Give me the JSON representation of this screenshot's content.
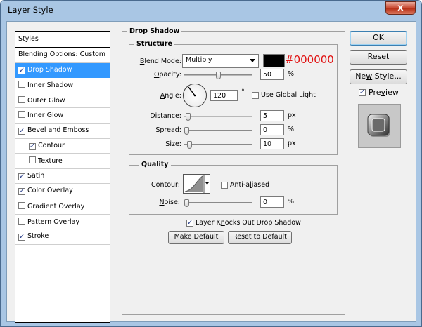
{
  "window": {
    "title": "Layer Style",
    "close_label": "x"
  },
  "styles_panel": {
    "header": "Styles",
    "items": [
      {
        "label": "Blending Options: Custom",
        "checkbox": false,
        "checked": false,
        "indent": false,
        "selected": false
      },
      {
        "label": "Drop Shadow",
        "checkbox": true,
        "checked": true,
        "indent": false,
        "selected": true
      },
      {
        "label": "Inner Shadow",
        "checkbox": true,
        "checked": false,
        "indent": false,
        "selected": false
      },
      {
        "label": "Outer Glow",
        "checkbox": true,
        "checked": false,
        "indent": false,
        "selected": false
      },
      {
        "label": "Inner Glow",
        "checkbox": true,
        "checked": false,
        "indent": false,
        "selected": false
      },
      {
        "label": "Bevel and Emboss",
        "checkbox": true,
        "checked": true,
        "indent": false,
        "selected": false
      },
      {
        "label": "Contour",
        "checkbox": true,
        "checked": true,
        "indent": true,
        "selected": false
      },
      {
        "label": "Texture",
        "checkbox": true,
        "checked": false,
        "indent": true,
        "selected": false
      },
      {
        "label": "Satin",
        "checkbox": true,
        "checked": true,
        "indent": false,
        "selected": false
      },
      {
        "label": "Color Overlay",
        "checkbox": true,
        "checked": true,
        "indent": false,
        "selected": false
      },
      {
        "label": "Gradient Overlay",
        "checkbox": true,
        "checked": false,
        "indent": false,
        "selected": false
      },
      {
        "label": "Pattern Overlay",
        "checkbox": true,
        "checked": false,
        "indent": false,
        "selected": false
      },
      {
        "label": "Stroke",
        "checkbox": true,
        "checked": true,
        "indent": false,
        "selected": false
      }
    ]
  },
  "drop_shadow": {
    "title": "Drop Shadow",
    "structure": {
      "title": "Structure",
      "blend_mode": {
        "label_u": "B",
        "label_rest": "lend Mode:",
        "value": "Multiply"
      },
      "color_hex": "#000000",
      "opacity": {
        "label_u": "O",
        "label_rest": "pacity:",
        "value": "50",
        "unit": "%",
        "fraction": 0.5
      },
      "angle": {
        "label_u": "A",
        "label_rest": "ngle:",
        "value": "120",
        "unit": "°",
        "global_light_u": "G",
        "global_light_pre": "Use ",
        "global_light_rest": "lobal Light",
        "global_light_checked": false
      },
      "distance": {
        "label_u": "D",
        "label_rest": "istance:",
        "value": "5",
        "unit": "px",
        "fraction": 0.02
      },
      "spread": {
        "label_pre": "Sp",
        "label_u": "r",
        "label_rest": "ead:",
        "value": "0",
        "unit": "%",
        "fraction": 0.0
      },
      "size": {
        "label_u": "S",
        "label_rest": "ize:",
        "value": "10",
        "unit": "px",
        "fraction": 0.04
      }
    },
    "quality": {
      "title": "Quality",
      "contour_label": "Contour:",
      "anti_aliased": {
        "label_pre": "Anti-a",
        "label_u": "l",
        "label_rest": "iased",
        "checked": false
      },
      "noise": {
        "label_u": "N",
        "label_rest": "oise:",
        "value": "0",
        "unit": "%",
        "fraction": 0.0
      }
    },
    "knocks_out": {
      "label_pre": "Layer K",
      "label_u": "n",
      "label_rest": "ocks Out Drop Shadow",
      "checked": true
    },
    "make_default": "Make Default",
    "reset_default": "Reset to Default"
  },
  "buttons": {
    "ok": "OK",
    "reset": "Reset",
    "new_style_pre": "Ne",
    "new_style_u": "w",
    "new_style_rest": " Style...",
    "preview_pre": "Pre",
    "preview_u": "v",
    "preview_rest": "iew",
    "preview_checked": true
  },
  "colors": {
    "selection": "#3399ff",
    "hex_text": "#e01010",
    "title_bar": "#a9c6e4"
  }
}
